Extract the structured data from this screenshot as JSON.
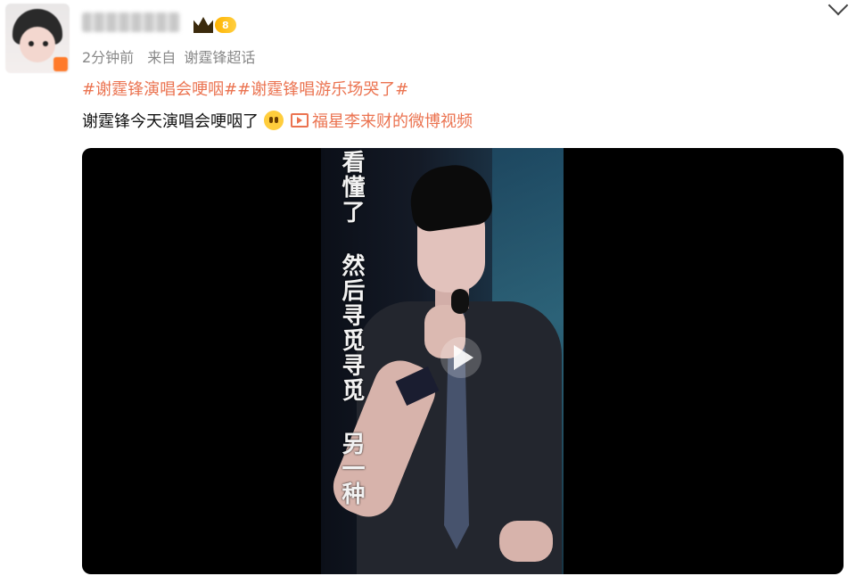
{
  "post": {
    "vip_level": "8",
    "time": "2分钟前",
    "source_prefix": "来自",
    "source": "谢霆锋超话",
    "topics": "#谢霆锋演唱会哽咽##谢霆锋唱游乐场哭了#",
    "text": "谢霆锋今天演唱会哽咽了",
    "video_link": "福星李来财的微博视频"
  },
  "video": {
    "lyrics": "看懂了 然后寻觅寻觅 另一种"
  },
  "icons": {
    "avatar": "user-avatar",
    "vip": "crown-icon",
    "emoji": "crying-emoji-icon",
    "video_link": "video-icon",
    "play": "play-icon",
    "more": "chevron-down-icon"
  },
  "colors": {
    "accent": "#eb7350",
    "meta": "#888888",
    "text": "#111111"
  }
}
